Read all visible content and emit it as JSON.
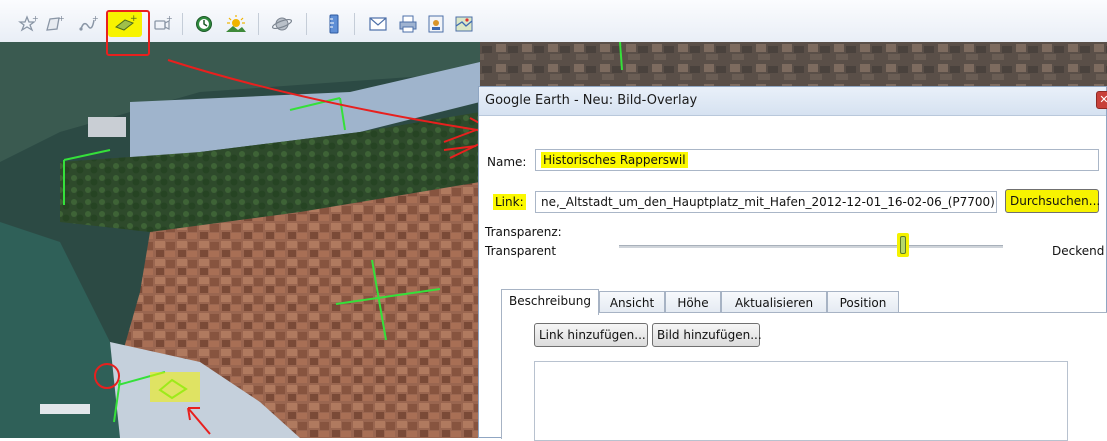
{
  "toolbar": {
    "icons": [
      {
        "name": "add-placemark-icon"
      },
      {
        "name": "add-polygon-icon"
      },
      {
        "name": "add-path-icon"
      },
      {
        "name": "add-image-overlay-icon"
      },
      {
        "name": "record-tour-icon"
      },
      {
        "name": "historical-imagery-icon"
      },
      {
        "name": "sunlight-icon"
      },
      {
        "name": "switch-to-sky-icon"
      },
      {
        "name": "ruler-icon"
      },
      {
        "name": "email-icon"
      },
      {
        "name": "print-icon"
      },
      {
        "name": "save-image-icon"
      },
      {
        "name": "view-in-maps-icon"
      }
    ],
    "highlight_color": "#f7f300"
  },
  "dialog": {
    "title": "Google Earth - Neu: Bild-Overlay",
    "name_label": "Name:",
    "name_value": "Historisches Rapperswil",
    "link_label": "Link:",
    "link_value": "ne,_Altstadt_um_den_Hauptplatz_mit_Hafen_2012-12-01_16-02-06_(P7700).JPG",
    "browse_button": "Durchsuchen...",
    "transparency_label": "Transparenz:",
    "transparent_label": "Transparent",
    "opaque_label": "Deckend",
    "transparency_level": 0.74,
    "tabs": [
      {
        "label": "Beschreibung"
      },
      {
        "label": "Ansicht"
      },
      {
        "label": "Höhe"
      },
      {
        "label": "Aktualisieren"
      },
      {
        "label": "Position"
      }
    ],
    "add_link_button": "Link hinzufügen...",
    "add_image_button": "Bild hinzufügen...",
    "description_value": ""
  },
  "annotations": {
    "marker_color": "#e8201e",
    "handle_color": "#35e03a",
    "highlight_color": "#f4f200"
  }
}
